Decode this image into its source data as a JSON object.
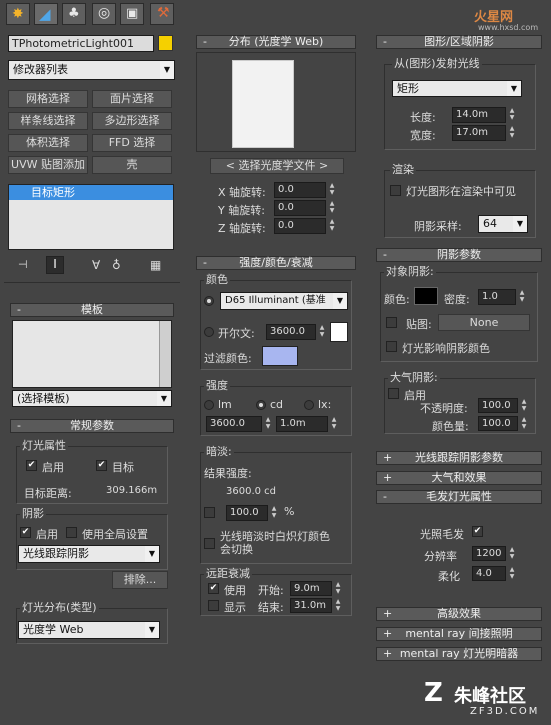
{
  "tabs": [
    {
      "icon": "sun-create-icon"
    },
    {
      "icon": "modify-icon"
    },
    {
      "icon": "hierarchy-icon"
    },
    {
      "icon": "motion-icon"
    },
    {
      "icon": "display-icon"
    },
    {
      "icon": "utilities-icon"
    }
  ],
  "watermark": {
    "site": "火星网",
    "url": "www.hxsd.com",
    "brand": "朱峰社区",
    "brand_url": "ZF3D.COM"
  },
  "left": {
    "object_name": "TPhotometricLight001",
    "color_swatch": "#f5d000",
    "modifier_list": "修改器列表",
    "buttons": [
      "网格选择",
      "面片选择",
      "样条线选择",
      "多边形选择",
      "体积选择",
      "FFD 选择",
      "UVW 贴图添加",
      "壳"
    ],
    "stack_item": "目标矩形",
    "template": {
      "title": "模板",
      "select": "(选择模板)"
    },
    "general": {
      "title": "常规参数",
      "light_props": "灯光属性",
      "enabled": "启用",
      "target": "目标",
      "target_dist_label": "目标距离:",
      "target_dist": "309.166m",
      "shadows": "阴影",
      "shadow_on": "启用",
      "use_global": "使用全局设置",
      "shadow_type": "光线跟踪阴影",
      "exclude": "排除...",
      "distribution": "灯光分布(类型)",
      "dist_type": "光度学 Web"
    }
  },
  "mid": {
    "web": {
      "title": "分布 (光度学 Web)",
      "choose": "< 选择光度学文件 >",
      "rows": [
        {
          "label": "X 轴旋转:",
          "value": "0.0"
        },
        {
          "label": "Y 轴旋转:",
          "value": "0.0"
        },
        {
          "label": "Z 轴旋转:",
          "value": "0.0"
        }
      ]
    },
    "intensity": {
      "title": "强度/颜色/衰减",
      "color": "颜色",
      "preset": "D65 Illuminant (基准",
      "kelvin": "开尔文:",
      "kelvin_val": "3600.0",
      "kelvin_color": "#ffffff",
      "filter": "过滤颜色:",
      "filter_color": "#a8b6f0",
      "strength": "强度",
      "lm": "lm",
      "cd": "cd",
      "lx": "lx:",
      "val1": "3600.0",
      "val2": "1.0m",
      "dim": "暗淡:",
      "result": "结果强度:",
      "result_val": "3600.0 cd",
      "pct_val": "100.0",
      "pct": "%",
      "incandescent": "光线暗淡时白炽灯颜色会切换",
      "far": "远距衰减",
      "use": "使用",
      "start": "开始:",
      "start_val": "9.0m",
      "show": "显示",
      "end": "结束:",
      "end_val": "31.0m"
    }
  },
  "right": {
    "shape": {
      "title": "图形/区域阴影",
      "emit": "从(图形)发射光线",
      "shape_type": "矩形",
      "length": "长度:",
      "length_val": "14.0m",
      "width": "宽度:",
      "width_val": "17.0m",
      "render": "渲染",
      "visible": "灯光图形在渲染中可见",
      "samples": "阴影采样:",
      "samples_val": "64"
    },
    "shadow_params": {
      "title": "阴影参数",
      "object_shadows": "对象阴影:",
      "color": "颜色:",
      "color_val": "#000000",
      "density": "密度:",
      "density_val": "1.0",
      "map": "贴图:",
      "map_val": "None",
      "affect": "灯光影响阴影颜色",
      "atmos": "大气阴影:",
      "atmos_on": "启用",
      "opacity": "不透明度:",
      "opacity_val": "100.0",
      "color_amt": "颜色量:",
      "color_amt_val": "100.0"
    },
    "rt_params": "光线跟踪阴影参数",
    "atmos_effects": "大气和效果",
    "hair": {
      "title": "毛发灯光属性",
      "light_hair": "光照毛发",
      "resolution": "分辨率",
      "res_val": "1200",
      "soft": "柔化",
      "soft_val": "4.0"
    },
    "advanced": "高级效果",
    "mr_indirect": "mental ray 间接照明",
    "mr_shader": "mental ray 灯光明暗器"
  }
}
